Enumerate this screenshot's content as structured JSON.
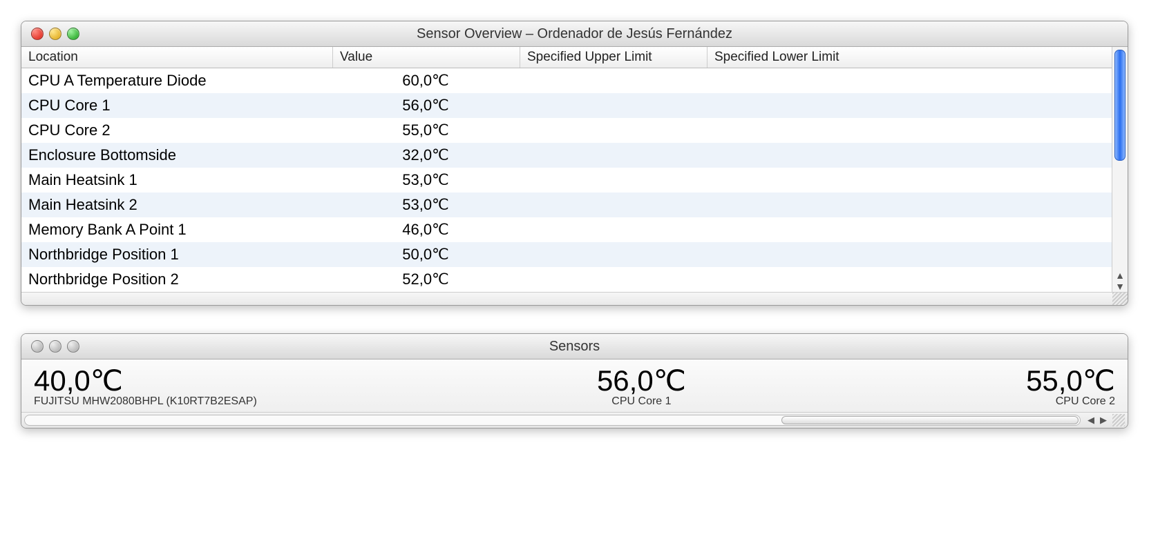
{
  "overview_window": {
    "title": "Sensor Overview – Ordenador de Jesús Fernández",
    "columns": {
      "location": "Location",
      "value": "Value",
      "upper": "Specified Upper Limit",
      "lower": "Specified Lower Limit"
    },
    "rows": [
      {
        "location": "CPU A Temperature Diode",
        "value": "60,0℃",
        "upper": "",
        "lower": ""
      },
      {
        "location": "CPU Core 1",
        "value": "56,0℃",
        "upper": "",
        "lower": ""
      },
      {
        "location": "CPU Core 2",
        "value": "55,0℃",
        "upper": "",
        "lower": ""
      },
      {
        "location": "Enclosure Bottomside",
        "value": "32,0℃",
        "upper": "",
        "lower": ""
      },
      {
        "location": "Main Heatsink 1",
        "value": "53,0℃",
        "upper": "",
        "lower": ""
      },
      {
        "location": "Main Heatsink 2",
        "value": "53,0℃",
        "upper": "",
        "lower": ""
      },
      {
        "location": "Memory Bank A Point 1",
        "value": "46,0℃",
        "upper": "",
        "lower": ""
      },
      {
        "location": "Northbridge Position 1",
        "value": "50,0℃",
        "upper": "",
        "lower": ""
      },
      {
        "location": "Northbridge Position 2",
        "value": "52,0℃",
        "upper": "",
        "lower": ""
      }
    ]
  },
  "sensors_window": {
    "title": "Sensors",
    "items": [
      {
        "value": "40,0℃",
        "label": "FUJITSU MHW2080BHPL (K10RT7B2ESAP)"
      },
      {
        "value": "56,0℃",
        "label": "CPU Core 1"
      },
      {
        "value": "55,0℃",
        "label": "CPU Core 2"
      }
    ]
  }
}
